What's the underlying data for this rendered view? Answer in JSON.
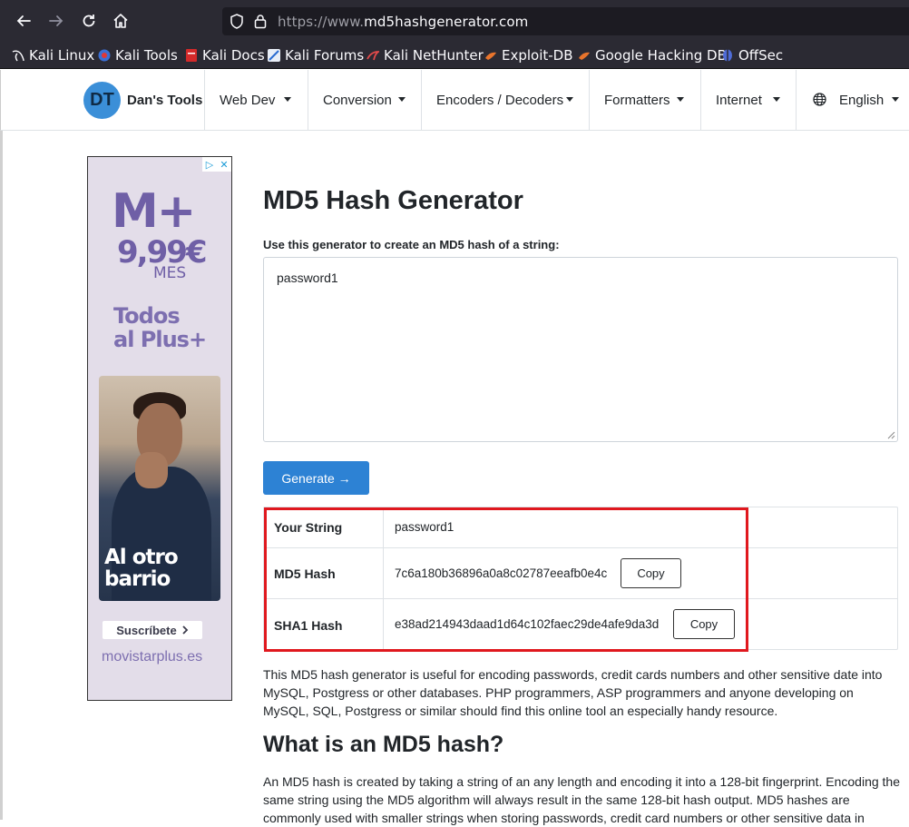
{
  "browser": {
    "url_prefix": "https://www.",
    "url_domain": "md5hashgenerator.com",
    "bookmarks": [
      {
        "label": "Kali Linux",
        "icon": "kali-dragon-icon"
      },
      {
        "label": "Kali Tools",
        "icon": "kali-tools-icon"
      },
      {
        "label": "Kali Docs",
        "icon": "kali-docs-icon"
      },
      {
        "label": "Kali Forums",
        "icon": "kali-forums-icon"
      },
      {
        "label": "Kali NetHunter",
        "icon": "nethunter-icon"
      },
      {
        "label": "Exploit-DB",
        "icon": "exploitdb-icon"
      },
      {
        "label": "Google Hacking DB",
        "icon": "ghdb-icon"
      },
      {
        "label": "OffSec",
        "icon": "offsec-icon"
      }
    ]
  },
  "header": {
    "logo_initials": "DT",
    "logo_text": "Dan's Tools",
    "nav": [
      "Web Dev",
      "Conversion",
      "Encoders / Decoders",
      "Formatters",
      "Internet"
    ],
    "language": "English"
  },
  "ad": {
    "brand": "M+",
    "price": "9,99€",
    "period": "MES",
    "headline_1": "Todos",
    "headline_2": "al Plus+",
    "photo_text_1": "Al otro",
    "photo_text_2": "barrio",
    "cta": "Suscríbete",
    "site": "movistarplus.es"
  },
  "main": {
    "title": "MD5 Hash Generator",
    "input_label": "Use this generator to create an MD5 hash of a string:",
    "input_value": "password1",
    "generate_label": "Generate →",
    "results": {
      "string_label": "Your String",
      "string_value": "password1",
      "md5_label": "MD5 Hash",
      "md5_value": "7c6a180b36896a0a8c02787eeafb0e4c",
      "sha1_label": "SHA1 Hash",
      "sha1_value": "e38ad214943daad1d64c102faec29de4afe9da3d",
      "copy_label": "Copy"
    },
    "description": "This MD5 hash generator is useful for encoding passwords, credit cards numbers and other sensitive date into MySQL, Postgress or other databases. PHP programmers, ASP programmers and anyone developing on MySQL, SQL, Postgress or similar should find this online tool an especially handy resource.",
    "h2": "What is an MD5 hash?",
    "description2": "An MD5 hash is created by taking a string of an any length and encoding it into a 128-bit fingerprint. Encoding the same string using the MD5 algorithm will always result in the same 128-bit hash output. MD5 hashes are commonly used with smaller strings when storing passwords, credit card numbers or other sensitive data in"
  },
  "colors": {
    "primary": "#2d82d4",
    "highlight": "#e0181e",
    "chrome": "#2b2a33",
    "ad_purple": "#6f5fa6"
  }
}
